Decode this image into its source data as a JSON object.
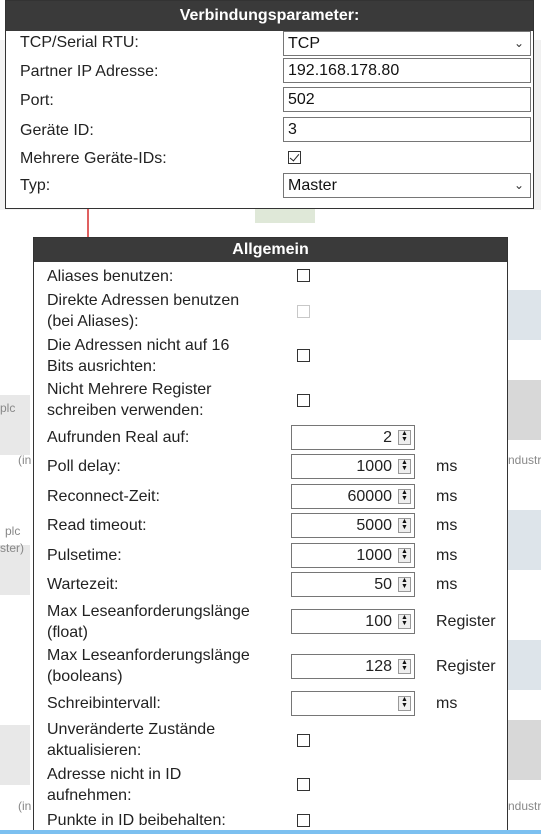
{
  "connection": {
    "title": "Verbindungsparameter:",
    "protocol_label": "TCP/Serial RTU:",
    "protocol_value": "TCP",
    "ip_label": "Partner IP Adresse:",
    "ip_value": "192.168.178.80",
    "port_label": "Port:",
    "port_value": "502",
    "device_id_label": "Geräte ID:",
    "device_id_value": "3",
    "multi_ids_label": "Mehrere Geräte-IDs:",
    "multi_ids_checked": true,
    "type_label": "Typ:",
    "type_value": "Master"
  },
  "general": {
    "title": "Allgemein",
    "aliases_label": "Aliases benutzen:",
    "direct_addr_label_1": "Direkte Adressen benutzen",
    "direct_addr_label_2": "(bei Aliases):",
    "align_label_1": "Die Adressen nicht auf 16",
    "align_label_2": "Bits ausrichten:",
    "no_multi_write_label_1": "Nicht Mehrere Register",
    "no_multi_write_label_2": "schreiben verwenden:",
    "round_real_label": "Aufrunden Real auf:",
    "round_real_value": "2",
    "poll_delay_label": "Poll delay:",
    "poll_delay_value": "1000",
    "poll_delay_unit": "ms",
    "reconnect_label": "Reconnect-Zeit:",
    "reconnect_value": "60000",
    "reconnect_unit": "ms",
    "read_timeout_label": "Read timeout:",
    "read_timeout_value": "5000",
    "read_timeout_unit": "ms",
    "pulsetime_label": "Pulsetime:",
    "pulsetime_value": "1000",
    "pulsetime_unit": "ms",
    "wait_label": "Wartezeit:",
    "wait_value": "50",
    "wait_unit": "ms",
    "max_float_label_1": "Max Leseanforderungslänge",
    "max_float_label_2": "(float)",
    "max_float_value": "100",
    "max_float_unit": "Register",
    "max_bool_label_1": "Max Leseanforderungslänge",
    "max_bool_label_2": "(booleans)",
    "max_bool_value": "128",
    "max_bool_unit": "Register",
    "write_interval_label": "Schreibintervall:",
    "write_interval_value": "",
    "write_interval_unit": "ms",
    "update_unchanged_label_1": "Unveränderte Zustände",
    "update_unchanged_label_2": "aktualisieren:",
    "addr_not_in_id_label_1": "Adresse nicht in ID",
    "addr_not_in_id_label_2": "aufnehmen:",
    "keep_dots_label": "Punkte in ID beibehalten:"
  },
  "background": {
    "plc_1": "plc",
    "plc_2": "plc",
    "plc_3": "ster)",
    "in_1": "(in",
    "in_2": "(in",
    "ndustri_1": "ndustri",
    "ndustri_2": "ndustri"
  }
}
